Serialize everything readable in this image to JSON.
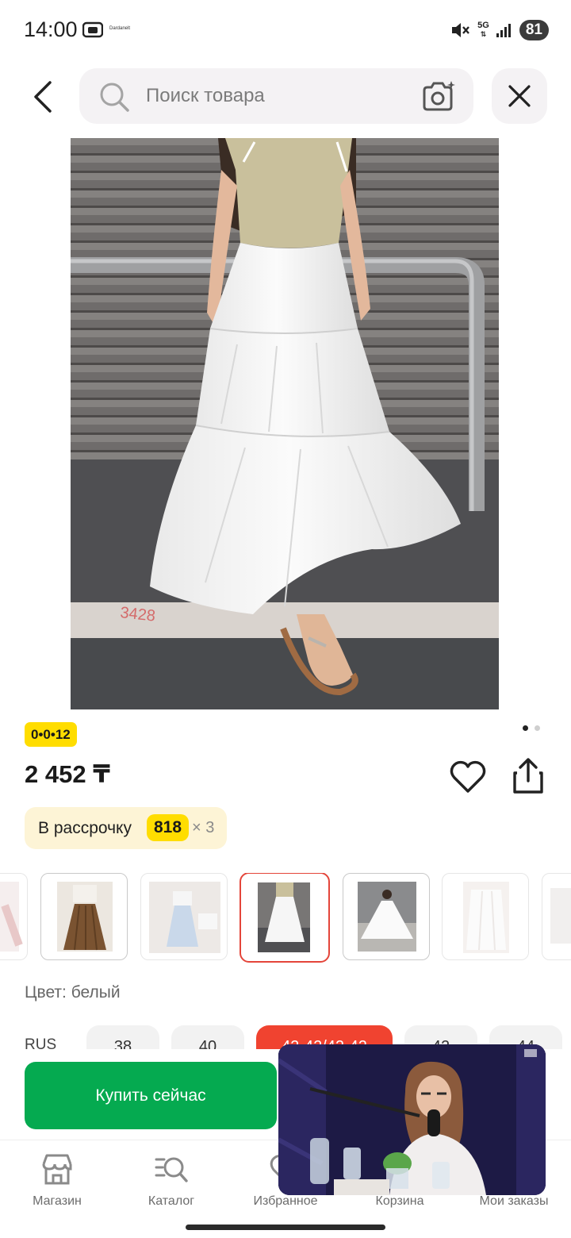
{
  "status_bar": {
    "time": "14:00",
    "mini_text": "Dardanelt",
    "network": "5G",
    "battery": "81"
  },
  "search": {
    "placeholder": "Поиск товара"
  },
  "product": {
    "promo_badge": "0•0•12",
    "price": "2 452 ₸",
    "installment": {
      "label": "В рассрочку",
      "amount": "818",
      "multiplier": "× 3"
    },
    "image_count": 2,
    "active_image": 1,
    "color_label": "Цвет: белый",
    "size_system": "RUS",
    "sizes": [
      "38",
      "40",
      "42-42/42-42",
      "42",
      "44"
    ],
    "selected_size": "42-42/42-42",
    "thumbnail_count": 7,
    "selected_thumbnail": 4
  },
  "actions": {
    "buy_now": "Купить сейчас"
  },
  "nav": {
    "items": [
      {
        "label": "Магазин",
        "icon": "shop-icon"
      },
      {
        "label": "Каталог",
        "icon": "catalog-search-icon"
      },
      {
        "label": "Избранное",
        "icon": "heart-icon"
      },
      {
        "label": "Корзина",
        "icon": "cart-icon"
      },
      {
        "label": "Мои заказы",
        "icon": "orders-icon"
      }
    ]
  },
  "colors": {
    "accent_green": "#05aa50",
    "accent_red": "#f04330",
    "badge_yellow": "#ffdd00",
    "installment_bg": "#fdf4d6"
  }
}
